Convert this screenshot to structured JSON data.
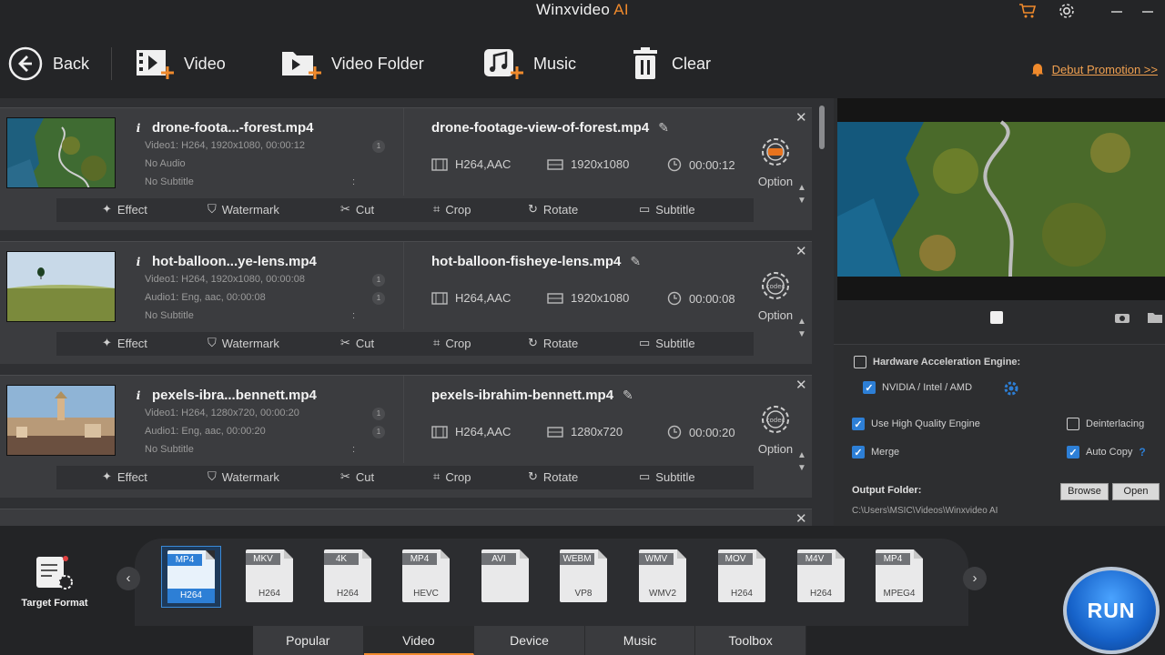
{
  "app": {
    "title_main": "Winxvideo",
    "title_ai": "AI"
  },
  "toolbar": {
    "back": "Back",
    "video": "Video",
    "video_folder": "Video Folder",
    "music": "Music",
    "clear": "Clear",
    "promo": "Debut Promotion >>"
  },
  "edit_labels": {
    "effect": "Effect",
    "watermark": "Watermark",
    "cut": "Cut",
    "crop": "Crop",
    "rotate": "Rotate",
    "subtitle": "Subtitle"
  },
  "option_label": "Option",
  "items": [
    {
      "short_name": "drone-foota...-forest.mp4",
      "video_info": "Video1: H264, 1920x1080, 00:00:12",
      "audio_info": "No Audio",
      "subtitle_info": "No Subtitle",
      "output_name": "drone-footage-view-of-forest.mp4",
      "codec": "H264,AAC",
      "resolution": "1920x1080",
      "duration": "00:00:12"
    },
    {
      "short_name": "hot-balloon...ye-lens.mp4",
      "video_info": "Video1: H264, 1920x1080, 00:00:08",
      "audio_info": "Audio1: Eng, aac, 00:00:08",
      "subtitle_info": "No Subtitle",
      "output_name": "hot-balloon-fisheye-lens.mp4",
      "codec": "H264,AAC",
      "resolution": "1920x1080",
      "duration": "00:00:08"
    },
    {
      "short_name": "pexels-ibra...bennett.mp4",
      "video_info": "Video1: H264, 1280x720, 00:00:20",
      "audio_info": "Audio1: Eng, aac, 00:00:20",
      "subtitle_info": "No Subtitle",
      "output_name": "pexels-ibrahim-bennett.mp4",
      "codec": "H264,AAC",
      "resolution": "1280x720",
      "duration": "00:00:20"
    }
  ],
  "settings": {
    "hw_accel": "Hardware Acceleration Engine:",
    "gpu": "NVIDIA / Intel / AMD",
    "high_quality": "Use High Quality Engine",
    "deinterlacing": "Deinterlacing",
    "merge": "Merge",
    "auto_copy": "Auto Copy",
    "output_folder_label": "Output Folder:",
    "browse": "Browse",
    "open": "Open",
    "output_path": "C:\\Users\\MSIC\\Videos\\Winxvideo AI",
    "hw_accel_checked": false,
    "gpu_checked": true,
    "high_quality_checked": true,
    "deinterlacing_checked": false,
    "merge_checked": true,
    "auto_copy_checked": true
  },
  "target_format_label": "Target Format",
  "formats": [
    {
      "tag": "MP4",
      "sub": "H264",
      "selected": true
    },
    {
      "tag": "MKV",
      "sub": "H264"
    },
    {
      "tag": "4K",
      "sub": "H264"
    },
    {
      "tag": "MP4",
      "sub": "HEVC"
    },
    {
      "tag": "AVI",
      "sub": ""
    },
    {
      "tag": "WEBM",
      "sub": "VP8"
    },
    {
      "tag": "WMV",
      "sub": "WMV2"
    },
    {
      "tag": "MOV",
      "sub": "H264"
    },
    {
      "tag": "M4V",
      "sub": "H264"
    },
    {
      "tag": "MP4",
      "sub": "MPEG4"
    }
  ],
  "tabs": [
    "Popular",
    "Video",
    "Device",
    "Music",
    "Toolbox"
  ],
  "active_tab": "Video",
  "run": "RUN",
  "colors": {
    "accent": "#f08a2c",
    "blue": "#2d7fd6"
  }
}
